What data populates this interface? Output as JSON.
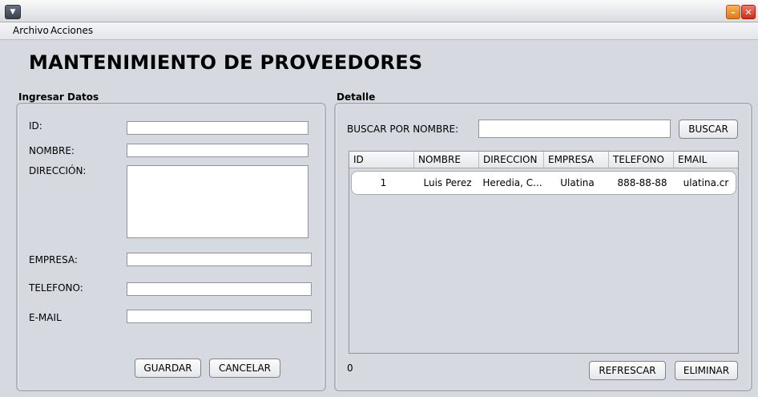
{
  "menubar": {
    "items": [
      "Archivo",
      "Acciones"
    ]
  },
  "page": {
    "title": "MANTENIMIENTO DE PROVEEDORES"
  },
  "form": {
    "section_title": "Ingresar Datos",
    "labels": {
      "id": "ID:",
      "nombre": "NOMBRE:",
      "direccion": "DIRECCIÓN:",
      "empresa": "EMPRESA:",
      "telefono": "TELEFONO:",
      "email": "E-MAIL"
    },
    "values": {
      "id": "",
      "nombre": "",
      "direccion": "",
      "empresa": "",
      "telefono": "",
      "email": ""
    },
    "buttons": {
      "save": "GUARDAR",
      "cancel": "CANCELAR"
    }
  },
  "detail": {
    "section_title": "Detalle",
    "search_label": "BUSCAR POR NOMBRE:",
    "search_value": "",
    "search_button": "BUSCAR",
    "table": {
      "columns": [
        "ID",
        "NOMBRE",
        "DIRECCION",
        "EMPRESA",
        "TELEFONO",
        "EMAIL"
      ],
      "rows": [
        [
          "1",
          "Luis Perez",
          "Heredia, C...",
          "Ulatina",
          "888-88-88",
          "ulatina.cr"
        ]
      ]
    },
    "count": "0",
    "buttons": {
      "refresh": "REFRESCAR",
      "delete": "ELIMINAR"
    }
  }
}
